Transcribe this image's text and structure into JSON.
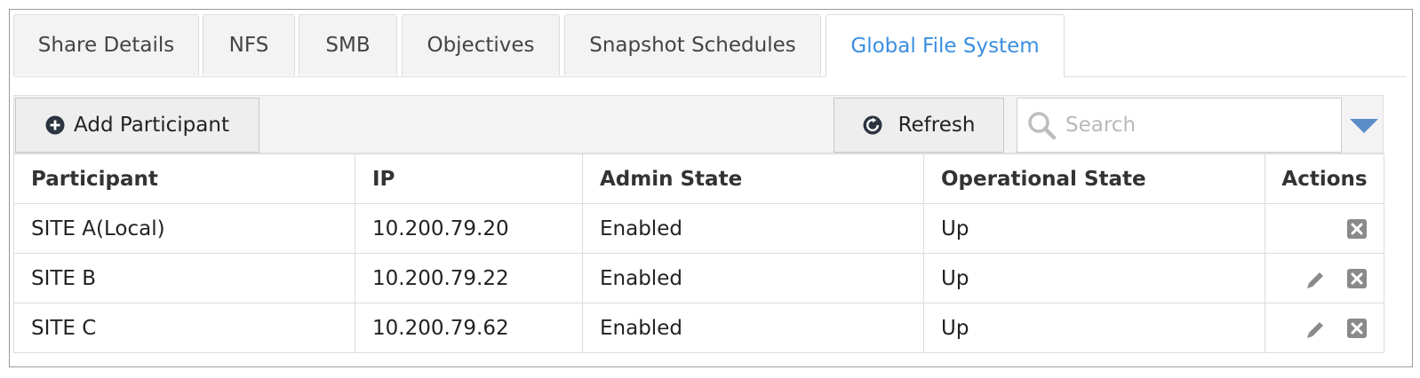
{
  "tabs": [
    {
      "label": "Share Details"
    },
    {
      "label": "NFS"
    },
    {
      "label": "SMB"
    },
    {
      "label": "Objectives"
    },
    {
      "label": "Snapshot Schedules"
    },
    {
      "label": "Global File System",
      "active": true
    }
  ],
  "toolbar": {
    "add_label": "Add Participant",
    "refresh_label": "Refresh",
    "search_placeholder": "Search",
    "icons": {
      "add": "plus-circle-icon",
      "refresh": "refresh-icon",
      "search": "search-icon",
      "dropdown": "caret-down-icon"
    }
  },
  "table": {
    "columns": [
      "Participant",
      "IP",
      "Admin State",
      "Operational State",
      "Actions"
    ],
    "rows": [
      {
        "participant": "SITE A(Local)",
        "ip": "10.200.79.20",
        "admin_state": "Enabled",
        "operational_state": "Up",
        "actions": [
          "delete"
        ]
      },
      {
        "participant": "SITE B",
        "ip": "10.200.79.22",
        "admin_state": "Enabled",
        "operational_state": "Up",
        "actions": [
          "edit",
          "delete"
        ]
      },
      {
        "participant": "SITE C",
        "ip": "10.200.79.62",
        "admin_state": "Enabled",
        "operational_state": "Up",
        "actions": [
          "edit",
          "delete"
        ]
      }
    ]
  },
  "colors": {
    "accent": "#3a8ee0",
    "icon_dark": "#2b3440",
    "icon_gray": "#8a8a8a",
    "dropdown": "#5b8ec9"
  }
}
